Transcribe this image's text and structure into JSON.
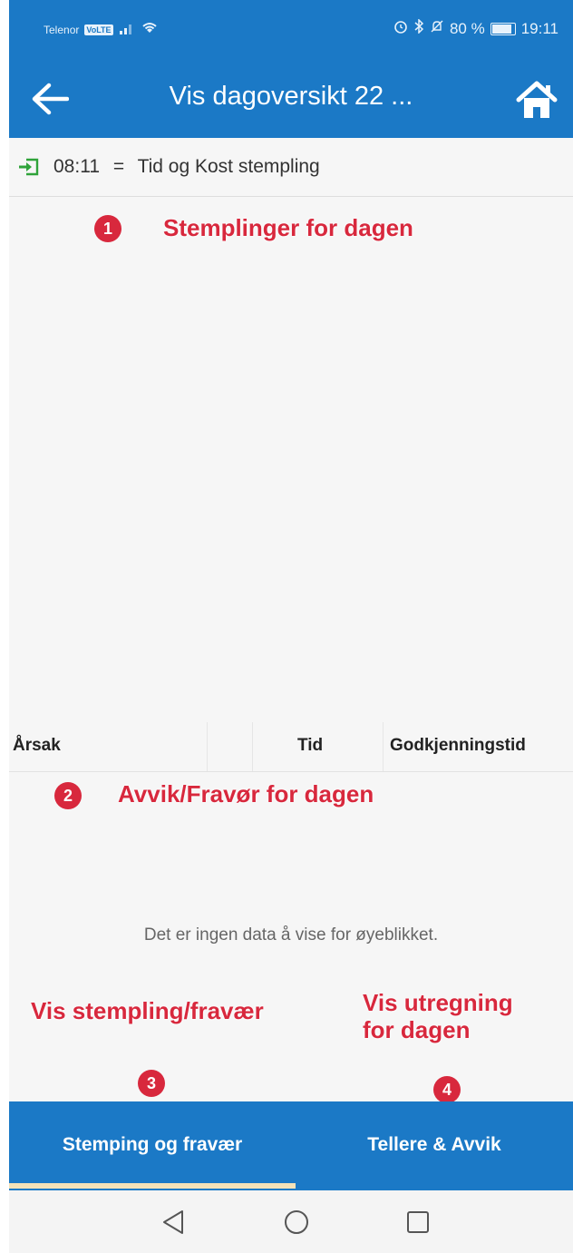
{
  "status_bar": {
    "carrier": "Telenor",
    "volte": "VoLTE",
    "battery": "80 %",
    "time": "19:11"
  },
  "app_bar": {
    "title": "Vis dagoversikt 22 ..."
  },
  "stamping": {
    "time": "08:11",
    "separator": "=",
    "description": "Tid og Kost stempling"
  },
  "table": {
    "columns": [
      "Årsak",
      "",
      "Tid",
      "Godkjenningstid"
    ],
    "empty_message": "Det er ingen data å vise for øyeblikket."
  },
  "annotations": {
    "a1": {
      "badge": "1",
      "text": "Stemplinger for dagen"
    },
    "a2": {
      "badge": "2",
      "text": "Avvik/Fravør for dagen"
    },
    "a3": {
      "badge": "3",
      "text": "Vis stempling/fravær"
    },
    "a4": {
      "badge": "4",
      "text_line1": "Vis utregning",
      "text_line2": "for dagen"
    }
  },
  "tabs": [
    {
      "label": "Stemping og fravær",
      "active": true
    },
    {
      "label": "Tellere & Avvik",
      "active": false
    }
  ],
  "colors": {
    "primary": "#1b79c6",
    "annotation": "#d8283d",
    "stamp_in_icon": "#2fa33a"
  },
  "icons": {
    "back": "arrow-left-icon",
    "home": "home-icon",
    "stamp_in": "sign-in-icon",
    "nav_back": "triangle-back-icon",
    "nav_home": "circle-home-icon",
    "nav_recent": "square-recent-icon"
  }
}
